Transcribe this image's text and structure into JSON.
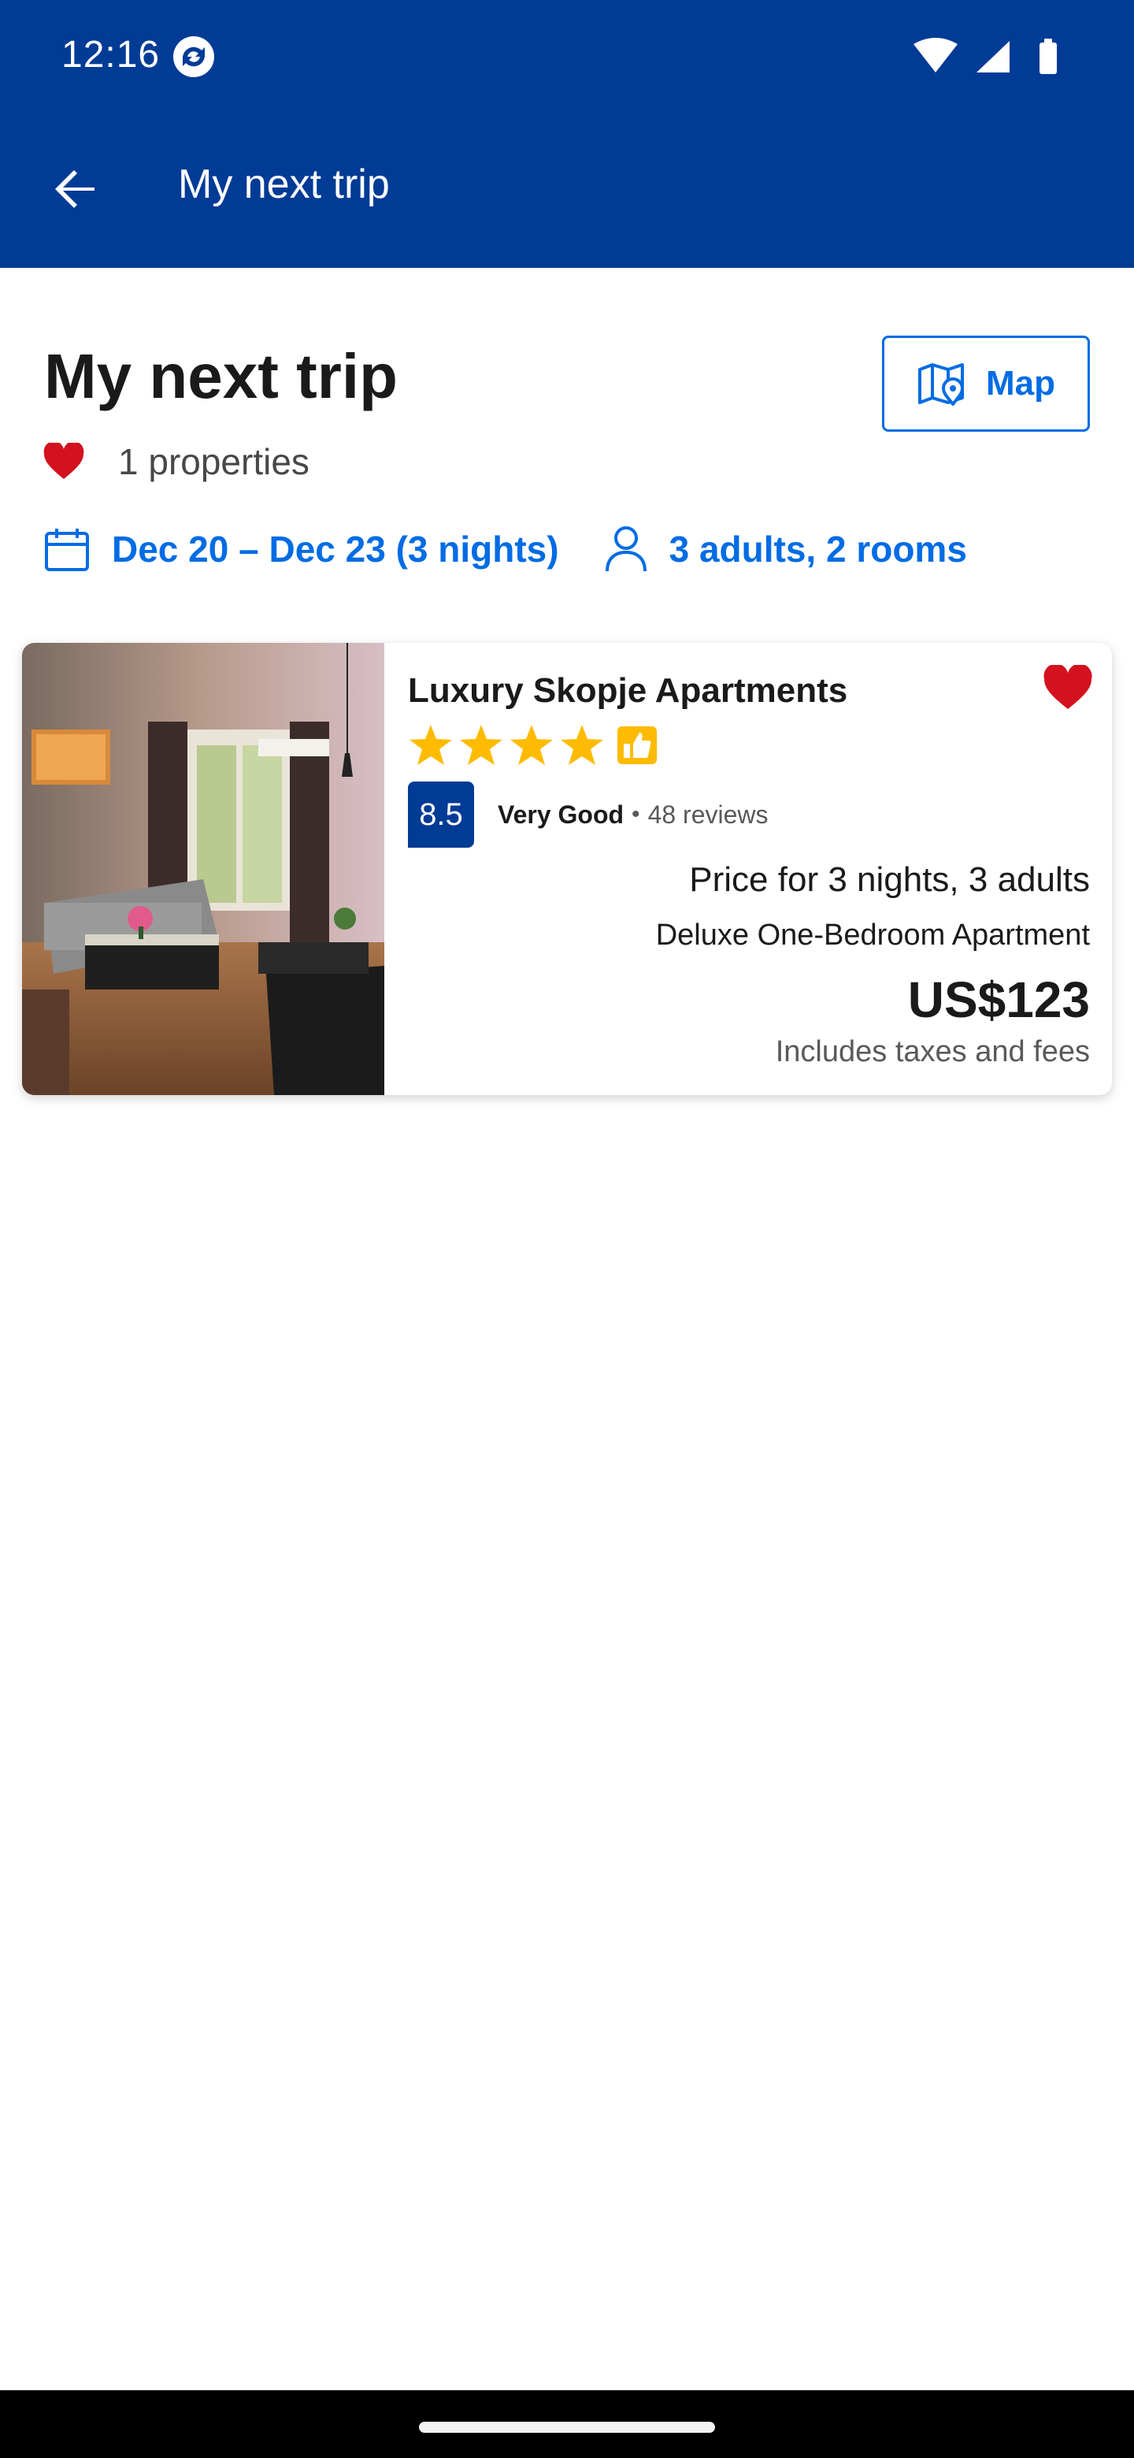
{
  "status_bar": {
    "time": "12:16"
  },
  "app_bar": {
    "title": "My next trip",
    "back_icon": "arrow-left-icon"
  },
  "list": {
    "title": "My next trip",
    "map_button": "Map",
    "saved_count": "1 properties",
    "dates": "Dec 20 – Dec 23 (3 nights)",
    "guests": "3 adults, 2 rooms"
  },
  "property": {
    "name": "Luxury Skopje Apartments",
    "stars": 4,
    "score": "8.5",
    "score_label": "Very Good",
    "dot": "•",
    "reviews": "48 reviews",
    "price_for": "Price for 3 nights, 3 adults",
    "room_type": "Deluxe One-Bedroom Apartment",
    "price": "US$123",
    "taxes": "Includes taxes and fees"
  },
  "colors": {
    "brand_blue": "#003b95",
    "link_blue": "#006ce4",
    "saved_red": "#d4111e",
    "star_yellow": "#febb02"
  }
}
